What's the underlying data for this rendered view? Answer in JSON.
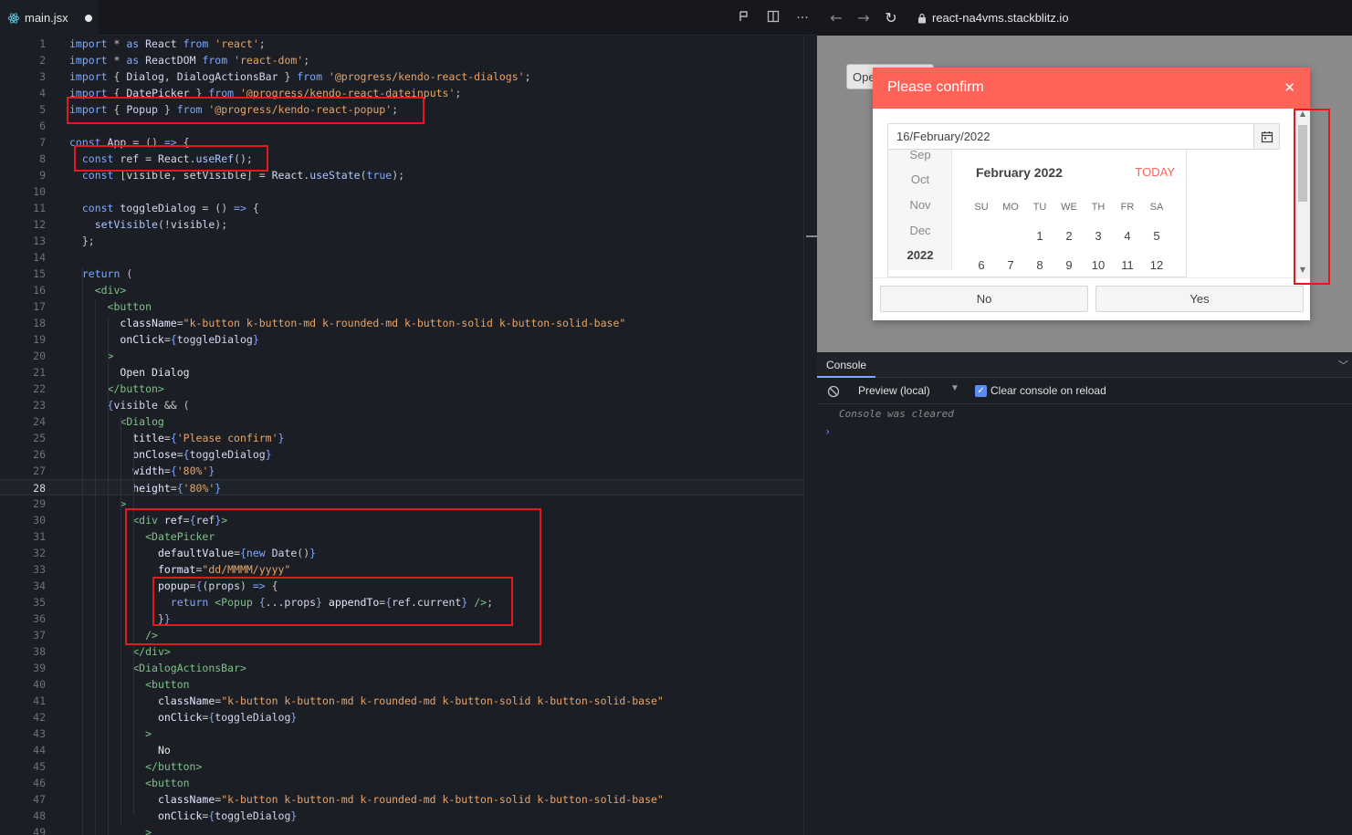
{
  "editor": {
    "tab": {
      "filename": "main.jsx"
    },
    "tools": {
      "run_icon": "run-icon",
      "split_icon": "split-icon",
      "more_label": "···"
    },
    "active_line": 28,
    "lines": [
      [
        [
          "kw",
          "import"
        ],
        [
          "pun",
          " * "
        ],
        [
          "kw",
          "as"
        ],
        [
          "id",
          " React "
        ],
        [
          "kw",
          "from"
        ],
        [
          "str",
          " 'react'"
        ],
        [
          "pun",
          ";"
        ]
      ],
      [
        [
          "kw",
          "import"
        ],
        [
          "pun",
          " * "
        ],
        [
          "kw",
          "as"
        ],
        [
          "id",
          " ReactDOM "
        ],
        [
          "kw",
          "from"
        ],
        [
          "str",
          " 'react-dom'"
        ],
        [
          "pun",
          ";"
        ]
      ],
      [
        [
          "kw",
          "import"
        ],
        [
          "pun",
          " { "
        ],
        [
          "id",
          "Dialog"
        ],
        [
          "pun",
          ", "
        ],
        [
          "id",
          "DialogActionsBar"
        ],
        [
          "pun",
          " } "
        ],
        [
          "kw",
          "from"
        ],
        [
          "str",
          " '@progress/kendo-react-dialogs'"
        ],
        [
          "pun",
          ";"
        ]
      ],
      [
        [
          "kw",
          "import"
        ],
        [
          "pun",
          " { "
        ],
        [
          "id",
          "DatePicker"
        ],
        [
          "pun",
          " } "
        ],
        [
          "kw",
          "from"
        ],
        [
          "str",
          " '@progress/kendo-react-dateinputs'"
        ],
        [
          "pun",
          ";"
        ]
      ],
      [
        [
          "kw",
          "import"
        ],
        [
          "pun",
          " { "
        ],
        [
          "id",
          "Popup"
        ],
        [
          "pun",
          " } "
        ],
        [
          "kw",
          "from"
        ],
        [
          "str",
          " '@progress/kendo-react-popup'"
        ],
        [
          "pun",
          ";"
        ]
      ],
      [],
      [
        [
          "kw",
          "const"
        ],
        [
          "id",
          " App"
        ],
        [
          "pun",
          " = () "
        ],
        [
          "kw",
          "=>"
        ],
        [
          "pun",
          " {"
        ]
      ],
      [
        [
          "pun",
          "  "
        ],
        [
          "kw",
          "const"
        ],
        [
          "id",
          " ref"
        ],
        [
          "pun",
          " = "
        ],
        [
          "id",
          "React"
        ],
        [
          "pun",
          "."
        ],
        [
          "fn",
          "useRef"
        ],
        [
          "pun",
          "();"
        ]
      ],
      [
        [
          "pun",
          "  "
        ],
        [
          "kw",
          "const"
        ],
        [
          "pun",
          " ["
        ],
        [
          "id",
          "visible"
        ],
        [
          "pun",
          ", "
        ],
        [
          "id",
          "setVisible"
        ],
        [
          "pun",
          "] = "
        ],
        [
          "id",
          "React"
        ],
        [
          "pun",
          "."
        ],
        [
          "fn",
          "useState"
        ],
        [
          "pun",
          "("
        ],
        [
          "kw",
          "true"
        ],
        [
          "pun",
          ");"
        ]
      ],
      [],
      [
        [
          "pun",
          "  "
        ],
        [
          "kw",
          "const"
        ],
        [
          "id",
          " toggleDialog"
        ],
        [
          "pun",
          " = () "
        ],
        [
          "kw",
          "=>"
        ],
        [
          "pun",
          " {"
        ]
      ],
      [
        [
          "pun",
          "    "
        ],
        [
          "fn",
          "setVisible"
        ],
        [
          "pun",
          "(!"
        ],
        [
          "id",
          "visible"
        ],
        [
          "pun",
          ");"
        ]
      ],
      [
        [
          "pun",
          "  };"
        ]
      ],
      [],
      [
        [
          "pun",
          "  "
        ],
        [
          "kw",
          "return"
        ],
        [
          "pun",
          " ("
        ]
      ],
      [
        [
          "pun",
          "    "
        ],
        [
          "tag",
          "<div>"
        ]
      ],
      [
        [
          "pun",
          "      "
        ],
        [
          "tag",
          "<button"
        ]
      ],
      [
        [
          "pun",
          "        "
        ],
        [
          "attr",
          "className"
        ],
        [
          "pun",
          "="
        ],
        [
          "str",
          "\"k-button k-button-md k-rounded-md k-button-solid k-button-solid-base\""
        ]
      ],
      [
        [
          "pun",
          "        "
        ],
        [
          "attr",
          "onClick"
        ],
        [
          "pun",
          "="
        ],
        [
          "kw",
          "{"
        ],
        [
          "id",
          "toggleDialog"
        ],
        [
          "kw",
          "}"
        ]
      ],
      [
        [
          "pun",
          "      "
        ],
        [
          "tag",
          ">"
        ]
      ],
      [
        [
          "pun",
          "        "
        ],
        [
          "txt",
          "Open Dialog"
        ]
      ],
      [
        [
          "pun",
          "      "
        ],
        [
          "tag",
          "</button>"
        ]
      ],
      [
        [
          "pun",
          "      "
        ],
        [
          "kw",
          "{"
        ],
        [
          "id",
          "visible"
        ],
        [
          "pun",
          " && ("
        ]
      ],
      [
        [
          "pun",
          "        "
        ],
        [
          "tag",
          "<Dialog"
        ]
      ],
      [
        [
          "pun",
          "          "
        ],
        [
          "attr",
          "title"
        ],
        [
          "pun",
          "="
        ],
        [
          "kw",
          "{"
        ],
        [
          "str",
          "'Please confirm'"
        ],
        [
          "kw",
          "}"
        ]
      ],
      [
        [
          "pun",
          "          "
        ],
        [
          "attr",
          "onClose"
        ],
        [
          "pun",
          "="
        ],
        [
          "kw",
          "{"
        ],
        [
          "id",
          "toggleDialog"
        ],
        [
          "kw",
          "}"
        ]
      ],
      [
        [
          "pun",
          "          "
        ],
        [
          "attr",
          "width"
        ],
        [
          "pun",
          "="
        ],
        [
          "kw",
          "{"
        ],
        [
          "str",
          "'80%'"
        ],
        [
          "kw",
          "}"
        ]
      ],
      [
        [
          "pun",
          "          "
        ],
        [
          "attr",
          "height"
        ],
        [
          "pun",
          "="
        ],
        [
          "kw",
          "{"
        ],
        [
          "str",
          "'80%'"
        ],
        [
          "kw",
          "}"
        ]
      ],
      [
        [
          "pun",
          "        "
        ],
        [
          "tag",
          ">"
        ]
      ],
      [
        [
          "pun",
          "          "
        ],
        [
          "tag",
          "<div"
        ],
        [
          "attr",
          " ref"
        ],
        [
          "pun",
          "="
        ],
        [
          "kw",
          "{"
        ],
        [
          "id",
          "ref"
        ],
        [
          "kw",
          "}"
        ],
        [
          "tag",
          ">"
        ]
      ],
      [
        [
          "pun",
          "            "
        ],
        [
          "tag",
          "<DatePicker"
        ]
      ],
      [
        [
          "pun",
          "              "
        ],
        [
          "attr",
          "defaultValue"
        ],
        [
          "pun",
          "="
        ],
        [
          "kw",
          "{new"
        ],
        [
          "id",
          " Date"
        ],
        [
          "pun",
          "()"
        ],
        [
          "kw",
          "}"
        ]
      ],
      [
        [
          "pun",
          "              "
        ],
        [
          "attr",
          "format"
        ],
        [
          "pun",
          "="
        ],
        [
          "str",
          "\"dd/MMMM/yyyy\""
        ]
      ],
      [
        [
          "pun",
          "              "
        ],
        [
          "attr",
          "popup"
        ],
        [
          "pun",
          "="
        ],
        [
          "kw",
          "{"
        ],
        [
          "pun",
          "("
        ],
        [
          "id",
          "props"
        ],
        [
          "pun",
          ") "
        ],
        [
          "kw",
          "=>"
        ],
        [
          "pun",
          " {"
        ]
      ],
      [
        [
          "pun",
          "                "
        ],
        [
          "kw",
          "return"
        ],
        [
          "tag",
          " <Popup"
        ],
        [
          "kw",
          " {"
        ],
        [
          "id",
          "...props"
        ],
        [
          "kw",
          "}"
        ],
        [
          "attr",
          " appendTo"
        ],
        [
          "pun",
          "="
        ],
        [
          "kw",
          "{"
        ],
        [
          "id",
          "ref.current"
        ],
        [
          "kw",
          "}"
        ],
        [
          "tag",
          " />"
        ],
        [
          "pun",
          ";"
        ]
      ],
      [
        [
          "pun",
          "              }"
        ],
        [
          "kw",
          "}"
        ]
      ],
      [
        [
          "pun",
          "            "
        ],
        [
          "tag",
          "/>"
        ]
      ],
      [
        [
          "pun",
          "          "
        ],
        [
          "tag",
          "</div>"
        ]
      ],
      [
        [
          "pun",
          "          "
        ],
        [
          "tag",
          "<DialogActionsBar>"
        ]
      ],
      [
        [
          "pun",
          "            "
        ],
        [
          "tag",
          "<button"
        ]
      ],
      [
        [
          "pun",
          "              "
        ],
        [
          "attr",
          "className"
        ],
        [
          "pun",
          "="
        ],
        [
          "str",
          "\"k-button k-button-md k-rounded-md k-button-solid k-button-solid-base\""
        ]
      ],
      [
        [
          "pun",
          "              "
        ],
        [
          "attr",
          "onClick"
        ],
        [
          "pun",
          "="
        ],
        [
          "kw",
          "{"
        ],
        [
          "id",
          "toggleDialog"
        ],
        [
          "kw",
          "}"
        ]
      ],
      [
        [
          "pun",
          "            "
        ],
        [
          "tag",
          ">"
        ]
      ],
      [
        [
          "pun",
          "              "
        ],
        [
          "txt",
          "No"
        ]
      ],
      [
        [
          "pun",
          "            "
        ],
        [
          "tag",
          "</button>"
        ]
      ],
      [
        [
          "pun",
          "            "
        ],
        [
          "tag",
          "<button"
        ]
      ],
      [
        [
          "pun",
          "              "
        ],
        [
          "attr",
          "className"
        ],
        [
          "pun",
          "="
        ],
        [
          "str",
          "\"k-button k-button-md k-rounded-md k-button-solid k-button-solid-base\""
        ]
      ],
      [
        [
          "pun",
          "              "
        ],
        [
          "attr",
          "onClick"
        ],
        [
          "pun",
          "="
        ],
        [
          "kw",
          "{"
        ],
        [
          "id",
          "toggleDialog"
        ],
        [
          "kw",
          "}"
        ]
      ],
      [
        [
          "pun",
          "            "
        ],
        [
          "tag",
          ">"
        ]
      ]
    ]
  },
  "browser": {
    "url": "react-na4vms.stackblitz.io",
    "icons": {
      "back": "←",
      "forward": "→",
      "reload": "↻"
    }
  },
  "preview": {
    "open_button_label": "Open Dialog",
    "dialog": {
      "title": "Please confirm",
      "close_glyph": "✕",
      "date_value": "16/February/2022",
      "navigator": [
        "Sep",
        "Oct",
        "Nov",
        "Dec",
        "2022"
      ],
      "calendar_title": "February 2022",
      "today_label": "TODAY",
      "weekdays": [
        "SU",
        "MO",
        "TU",
        "WE",
        "TH",
        "FR",
        "SA"
      ],
      "weeks": [
        [
          "",
          "",
          "1",
          "2",
          "3",
          "4",
          "5"
        ],
        [
          "6",
          "7",
          "8",
          "9",
          "10",
          "11",
          "12"
        ]
      ],
      "no_label": "No",
      "yes_label": "Yes"
    }
  },
  "console": {
    "tab_label": "Console",
    "context": "Preview (local)",
    "clear_on_reload_label": "Clear console on reload",
    "clear_on_reload_checked": true,
    "message": "Console was cleared",
    "prompt": "›"
  }
}
